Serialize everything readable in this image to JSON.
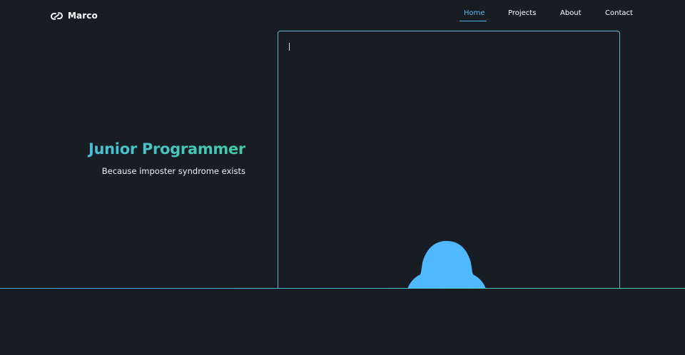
{
  "brand": {
    "name": "Marco",
    "logo_icon": "link-chain-icon"
  },
  "nav": {
    "items": [
      {
        "label": "Home",
        "active": true
      },
      {
        "label": "Projects",
        "active": false
      },
      {
        "label": "About",
        "active": false
      },
      {
        "label": "Contact",
        "active": false
      }
    ]
  },
  "hero": {
    "title": "Junior Programmer",
    "subtitle": "Because imposter syndrome exists"
  },
  "terminal": {
    "text": "",
    "figure_icon": "hooded-figure-icon"
  },
  "colors": {
    "background": "#181c23",
    "accent_blue": "#4fb8ff",
    "accent_teal": "#43c9a6",
    "nav_active": "#5eb6f2",
    "text": "#ffffff"
  }
}
